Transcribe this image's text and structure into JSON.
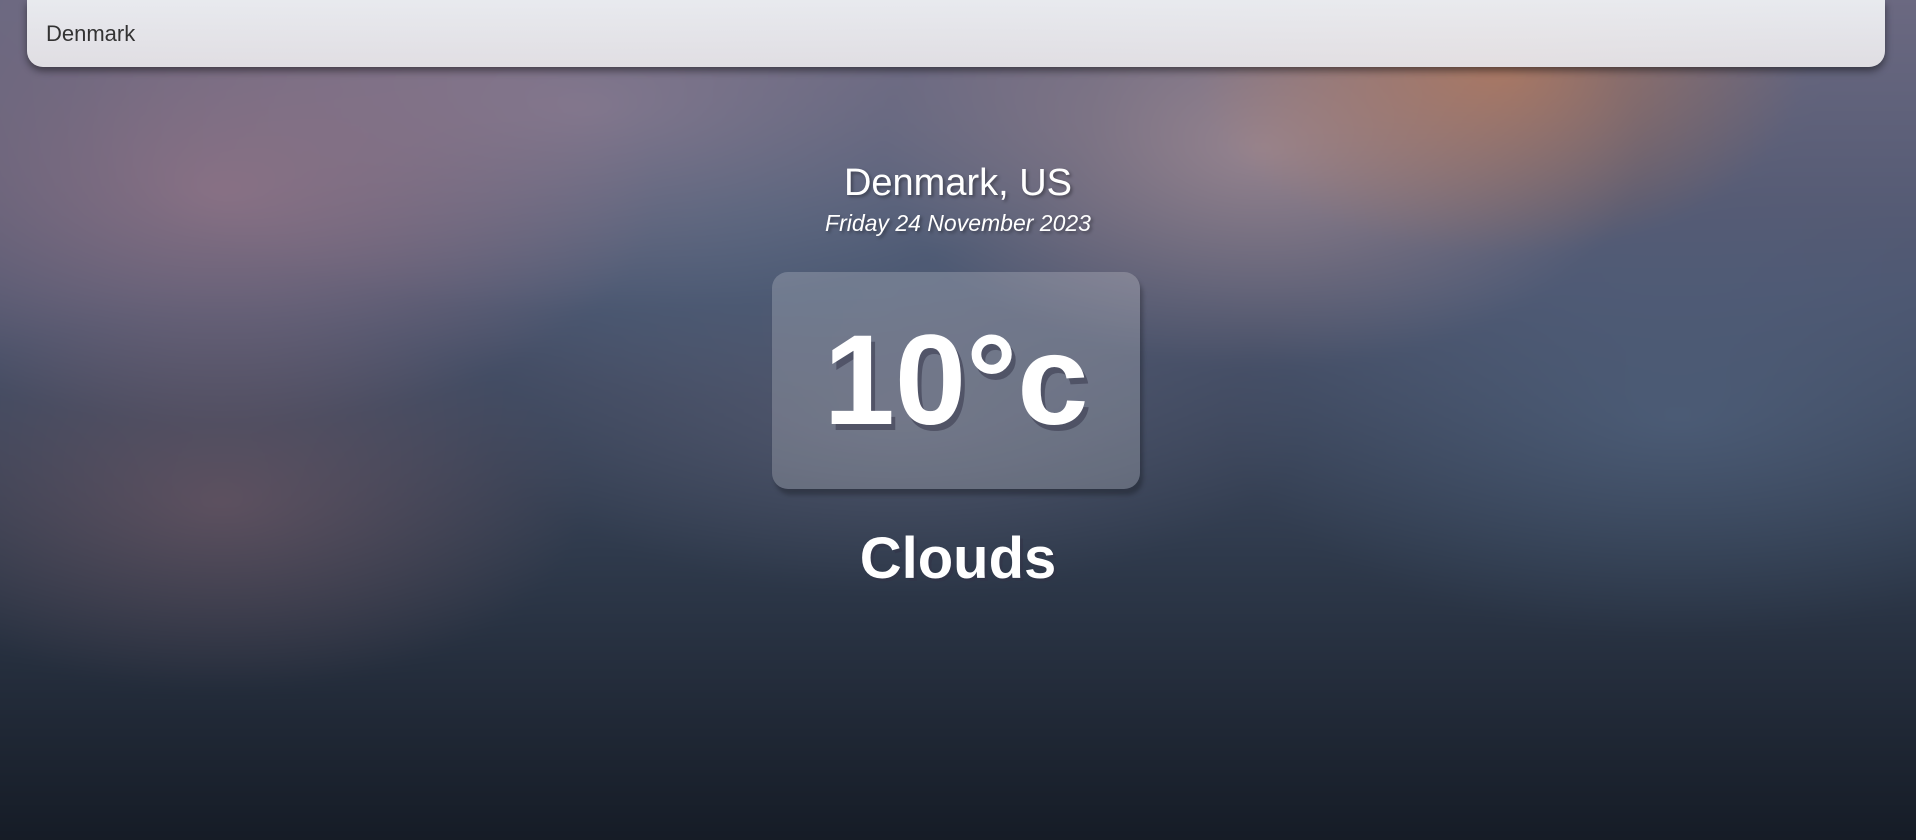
{
  "search": {
    "value": "Denmark"
  },
  "location": {
    "name": "Denmark, US",
    "date": "Friday 24 November 2023"
  },
  "weather": {
    "temperature": "10°c",
    "condition": "Clouds"
  }
}
